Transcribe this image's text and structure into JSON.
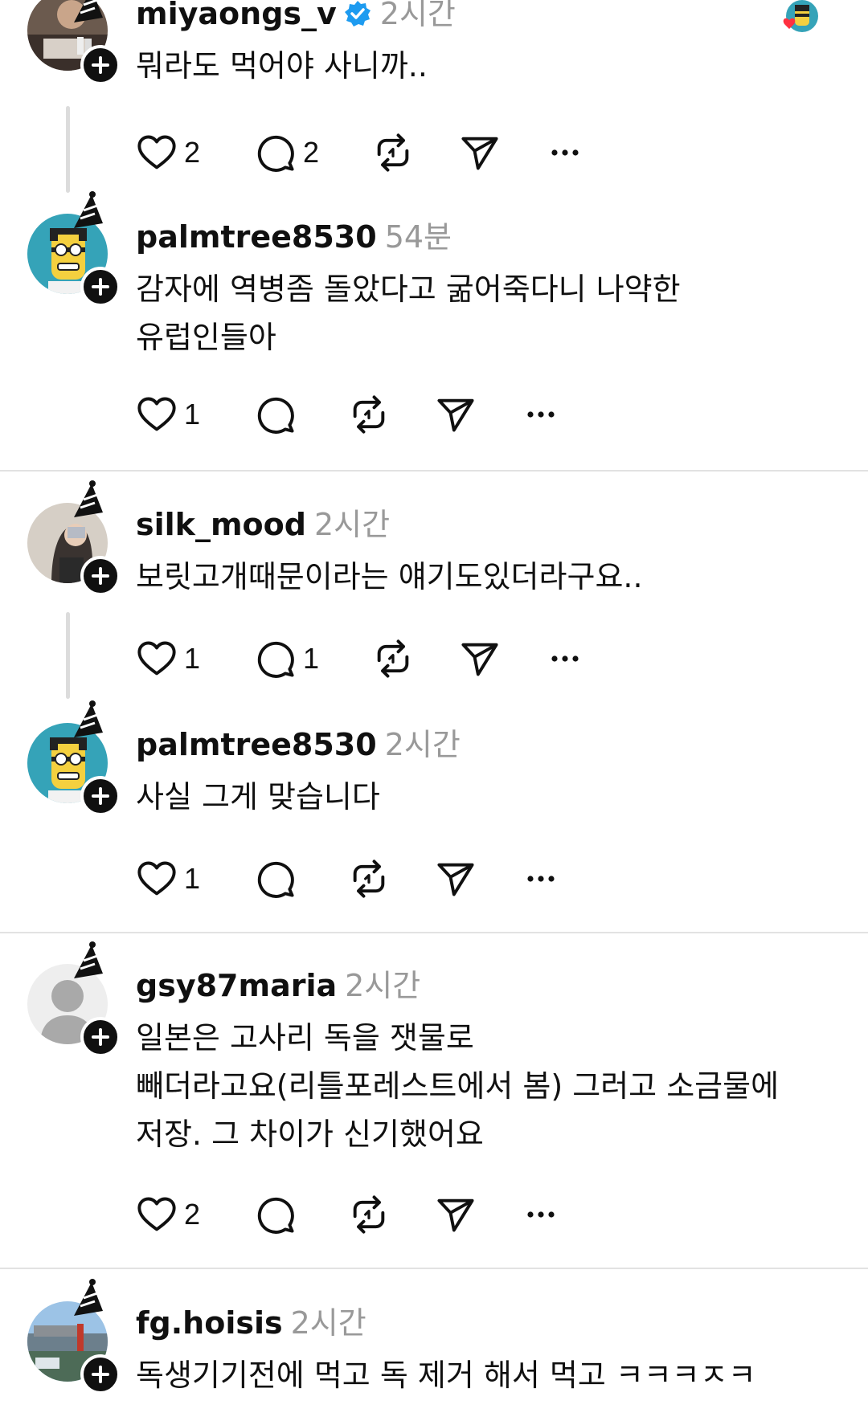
{
  "icons": {
    "like": "heart-icon",
    "reply": "comment-icon",
    "repost": "repost-icon",
    "share": "send-icon",
    "more": "more-icon",
    "add_follow": "plus-icon",
    "verified": "verified-badge-icon"
  },
  "colors": {
    "text": "#101010",
    "muted": "#999999",
    "verified": "#1d9bf0",
    "heart_reaction": "#ff3040"
  },
  "posts": [
    {
      "username": "miyaongs_v",
      "verified": true,
      "time": "2시간",
      "lines": [
        "뭐라도 먹어야 사니까.."
      ],
      "likes": "2",
      "replies": "2"
    },
    {
      "username": "palmtree8530",
      "time": "54분",
      "lines": [
        "감자에 역병좀 돌았다고 굶어죽다니 나약한",
        "유럽인들아"
      ],
      "likes": "1",
      "replies": ""
    },
    {
      "username": "silk_mood",
      "time": "2시간",
      "lines": [
        "보릿고개때문이라는 얘기도있더라구요.."
      ],
      "likes": "1",
      "replies": "1"
    },
    {
      "username": "palmtree8530",
      "time": "2시간",
      "lines": [
        "사실 그게 맞습니다"
      ],
      "likes": "1",
      "replies": ""
    },
    {
      "username": "gsy87maria",
      "time": "2시간",
      "lines": [
        "일본은 고사리 독을 잿물로",
        "빼더라고요(리틀포레스트에서 봄) 그러고 소금물에",
        "저장. 그 차이가 신기했어요"
      ],
      "likes": "2",
      "replies": ""
    },
    {
      "username": "fg.hoisis",
      "time": "2시간",
      "lines": [
        "독생기기전에 먹고 독 제거 해서 먹고 ㅋㅋㅋㅈㅋ"
      ],
      "likes": "",
      "replies": ""
    }
  ]
}
